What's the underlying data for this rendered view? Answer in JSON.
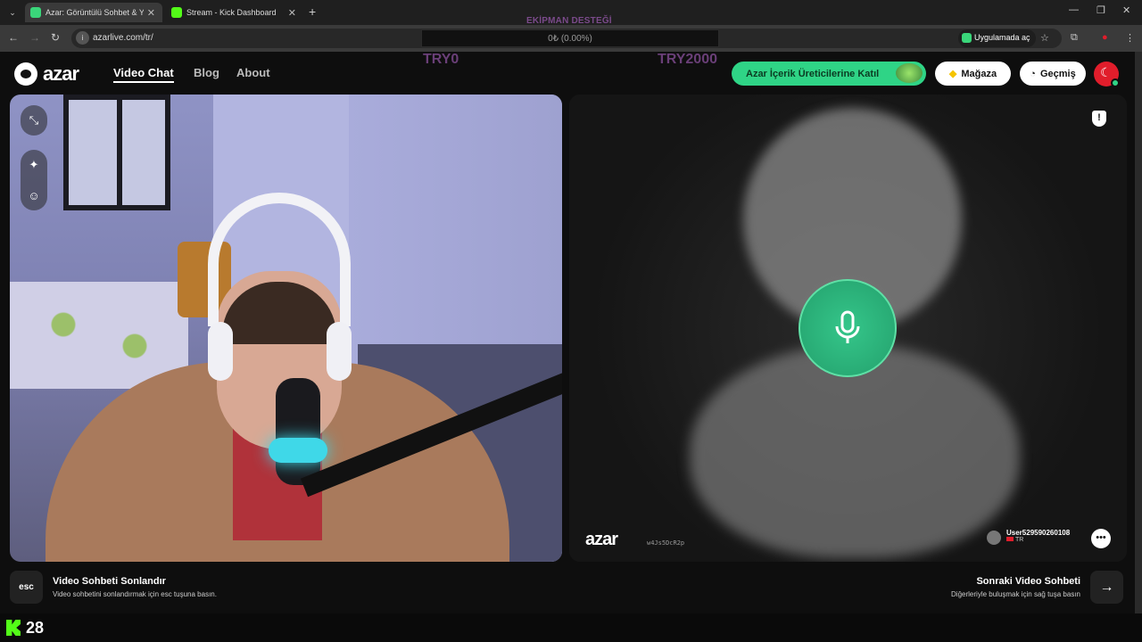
{
  "browser": {
    "tabs": [
      {
        "title": "Azar: Görüntülü Sohbet & Y",
        "active": true
      },
      {
        "title": "Stream - Kick Dashboard",
        "active": false
      }
    ],
    "url": "azarlive.com/tr/",
    "open_in_app": "Uygulamada aç"
  },
  "overlay": {
    "donation_title": "EKİPMAN DESTEĞİ",
    "donation_progress": "0₺ (0.00%)",
    "donation_fraction": 0,
    "goal_min": "TRY0",
    "goal_max": "TRY2000",
    "viewer_count": "28"
  },
  "header": {
    "logo": "azar",
    "nav": [
      "Video Chat",
      "Blog",
      "About"
    ],
    "creator_cta": "Azar İçerik Üreticilerine Katıl",
    "store": "Mağaza",
    "history": "Geçmiş"
  },
  "remote": {
    "watermark": "azar",
    "watermark_id": "w4Js5DcR2p",
    "username": "User529590260108",
    "country": "TR"
  },
  "footer": {
    "esc_key": "esc",
    "end_title": "Video Sohbeti Sonlandır",
    "end_desc": "Video sohbetini sonlandırmak için esc tuşuna basın.",
    "next_title": "Sonraki Video Sohbeti",
    "next_desc": "Diğerleriyle buluşmak için sağ tuşa basın"
  },
  "icons": {
    "accent_green": "#2fd486",
    "mic_button": "microphone-icon",
    "flag": "turkey-flag-icon"
  }
}
